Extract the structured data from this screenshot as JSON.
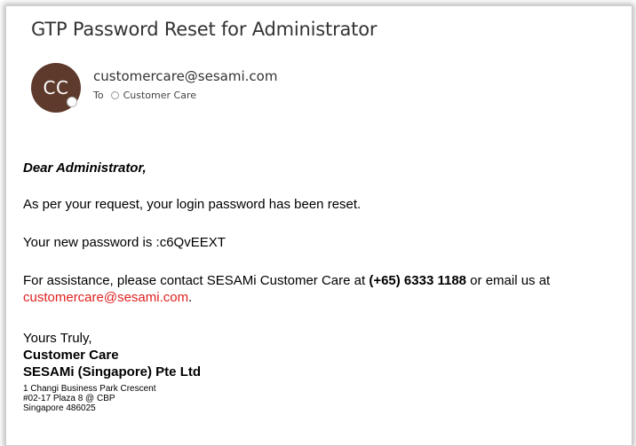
{
  "email": {
    "subject": "GTP Password Reset for Administrator",
    "avatar_initials": "CC",
    "avatar_color": "#5e3a2c",
    "sender": "customercare@sesami.com",
    "to_label": "To",
    "recipient": "Customer Care"
  },
  "body": {
    "greeting": "Dear Administrator,",
    "reset_line": "As per your request, your login password has been reset.",
    "password_line": "Your new password is :c6QvEEXT",
    "assist_prefix": "For assistance, please contact SESAMi Customer Care at ",
    "assist_phone": "(+65) 6333 1188",
    "assist_middle": " or email us at ",
    "assist_email": "customercare@sesami.com",
    "assist_suffix": ".",
    "link_color": "#e02020"
  },
  "signature": {
    "closing": "Yours Truly,",
    "name": "Customer Care",
    "company": "SESAMi (Singapore) Pte Ltd",
    "address_line1": "1 Changi Business Park Crescent",
    "address_line2": "#02-17 Plaza 8 @ CBP",
    "address_line3": "Singapore 486025"
  }
}
